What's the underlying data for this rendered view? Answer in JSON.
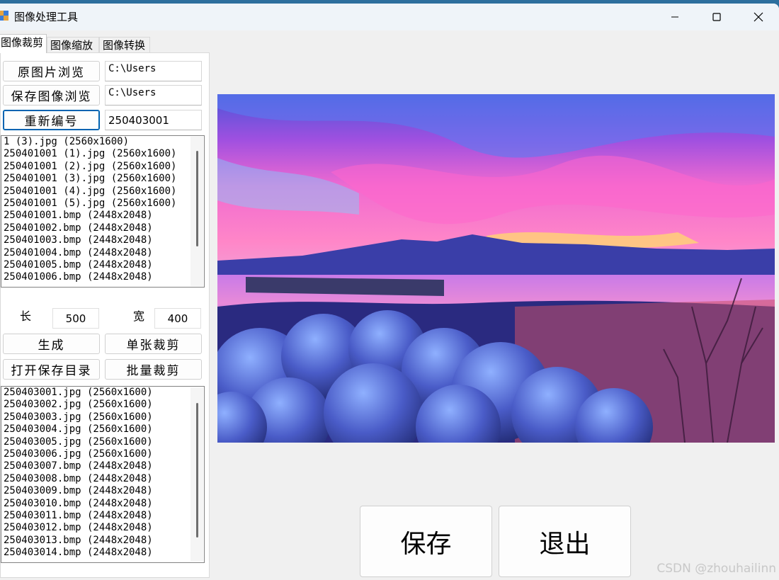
{
  "window": {
    "title": "图像处理工具",
    "controls": [
      "minimize",
      "maximize",
      "close"
    ]
  },
  "tabs": [
    {
      "label": "图像裁剪",
      "active": true
    },
    {
      "label": "图像缩放",
      "active": false
    },
    {
      "label": "图像转换",
      "active": false
    }
  ],
  "crop": {
    "browse_source_label": "原图片浏览",
    "source_path": "C:\\Users",
    "browse_save_label": "保存图像浏览",
    "save_path": "C:\\Users",
    "renumber_label": "重新编号",
    "renumber_value": "250403001",
    "source_files": [
      "1 (3).jpg (2560x1600)",
      "250401001 (1).jpg (2560x1600)",
      "250401001 (2).jpg (2560x1600)",
      "250401001 (3).jpg (2560x1600)",
      "250401001 (4).jpg (2560x1600)",
      "250401001 (5).jpg (2560x1600)",
      "250401001.bmp (2448x2048)",
      "250401002.bmp (2448x2048)",
      "250401003.bmp (2448x2048)",
      "250401004.bmp (2448x2048)",
      "250401005.bmp (2448x2048)",
      "250401006.bmp (2448x2048)"
    ],
    "length_label": "长",
    "length_value": "500",
    "width_label": "宽",
    "width_value": "400",
    "generate_label": "生成",
    "single_crop_label": "单张裁剪",
    "open_save_dir_label": "打开保存目录",
    "batch_crop_label": "批量裁剪",
    "output_files": [
      "250403001.jpg (2560x1600)",
      "250403002.jpg (2560x1600)",
      "250403003.jpg (2560x1600)",
      "250403004.jpg (2560x1600)",
      "250403005.jpg (2560x1600)",
      "250403006.jpg (2560x1600)",
      "250403007.bmp (2448x2048)",
      "250403008.bmp (2448x2048)",
      "250403009.bmp (2448x2048)",
      "250403010.bmp (2448x2048)",
      "250403011.bmp (2448x2048)",
      "250403012.bmp (2448x2048)",
      "250403013.bmp (2448x2048)",
      "250403014.bmp (2448x2048)"
    ]
  },
  "preview": {
    "icon": "landscape-image-icon"
  },
  "actions": {
    "save_label": "保存",
    "exit_label": "退出"
  },
  "watermark": "CSDN @zhouhailinn"
}
